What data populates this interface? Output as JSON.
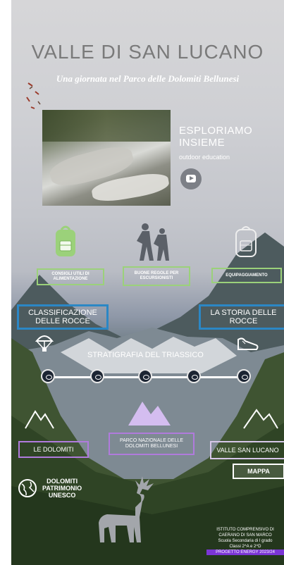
{
  "header": {
    "title": "VALLE DI SAN LUCANO",
    "subtitle": "Una giornata nel Parco delle Dolomiti Bellunesi"
  },
  "intro": {
    "explore_line1": "ESPLORIAMO",
    "explore_line2": "INSIEME",
    "tagline": "outdoor education"
  },
  "topics": {
    "alimentazione": "CONSIGLI UTILI DI ALIMENTAZIONE",
    "regole": "BUONE REGOLE PER ESCURSIONISTI",
    "equipaggiamento": "EQUIPAGGIAMENTO"
  },
  "rocks": {
    "classificazione": "CLASSIFICAZIONE DELLE ROCCE",
    "storia": "LA STORIA DELLE ROCCE",
    "stratigrafia": "STRATIGRAFIA DEL TRIASSICO"
  },
  "places": {
    "dolomiti": "LE DOLOMITI",
    "parco": "PARCO NAZIONALE DELLE DOLOMITI BELLUNESI",
    "valle": "VALLE SAN LUCANO",
    "mappa": "MAPPA"
  },
  "unesco": {
    "line1": "DOLOMITI",
    "line2": "PATRIMONIO",
    "line3": "UNESCO"
  },
  "footer": {
    "line1": "ISTITUTO COMPRENSIVO DI",
    "line2": "CAERANO DI SAN MARCO",
    "line3": "Scuola Secondaria di I grado",
    "line4": "Classi 2^A e 2^D",
    "project": "PROGETTO ENERGY 2023/24"
  },
  "icons": [
    "backpack-icon",
    "hikers-icon",
    "backpack-icon",
    "parachute-icon",
    "shoe-icon",
    "eye-icon",
    "mountain-icon",
    "globe-icon",
    "deer-icon",
    "youtube-icon"
  ],
  "colors": {
    "green": "#9bd17a",
    "blue": "#2b87c5",
    "purple": "#b07bdc",
    "highlight": "#7b35d6"
  }
}
